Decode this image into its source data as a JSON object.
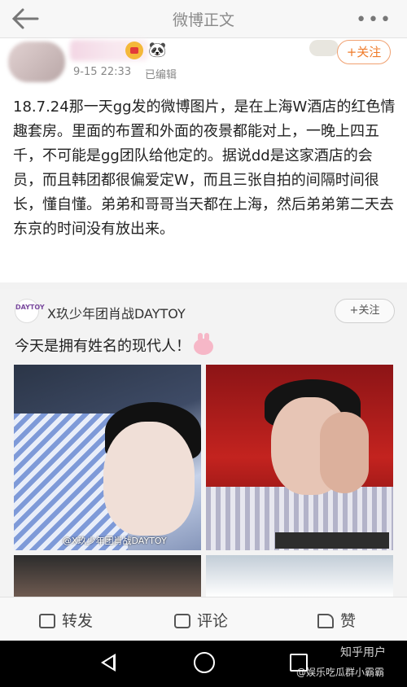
{
  "header": {
    "title": "微博正文",
    "more": "•••"
  },
  "post": {
    "time": "9-15 22:33",
    "edited": "已编辑",
    "follow_label": "+关注",
    "text": "18.7.24那一天gg发的微博图片，是在上海W酒店的红色情趣套房。里面的布置和外面的夜景都能对上，一晚上四五千，不可能是gg团队给他定的。据说dd是这家酒店的会员，而且韩团都很偏爱定W，而且三张自拍的间隔时间很长，懂自懂。弟弟和哥哥当天都在上海，然后弟弟第二天去东京的时间没有放出来。"
  },
  "repost": {
    "logo": "DAYTOY",
    "name": "X玖少年团肖战DAYTOY",
    "follow_label": "+关注",
    "text": "今天是拥有姓名的现代人！",
    "watermark": "@X玖少年团肖战DAYTOY"
  },
  "toolbar": {
    "repost": "转发",
    "comment": "评论",
    "like": "赞"
  },
  "watermark": {
    "line1": "知乎用户",
    "line2": "@娱乐吃瓜群小霸霸"
  },
  "colors": {
    "accent": "#ef7b2a",
    "navbar": "#000000"
  }
}
